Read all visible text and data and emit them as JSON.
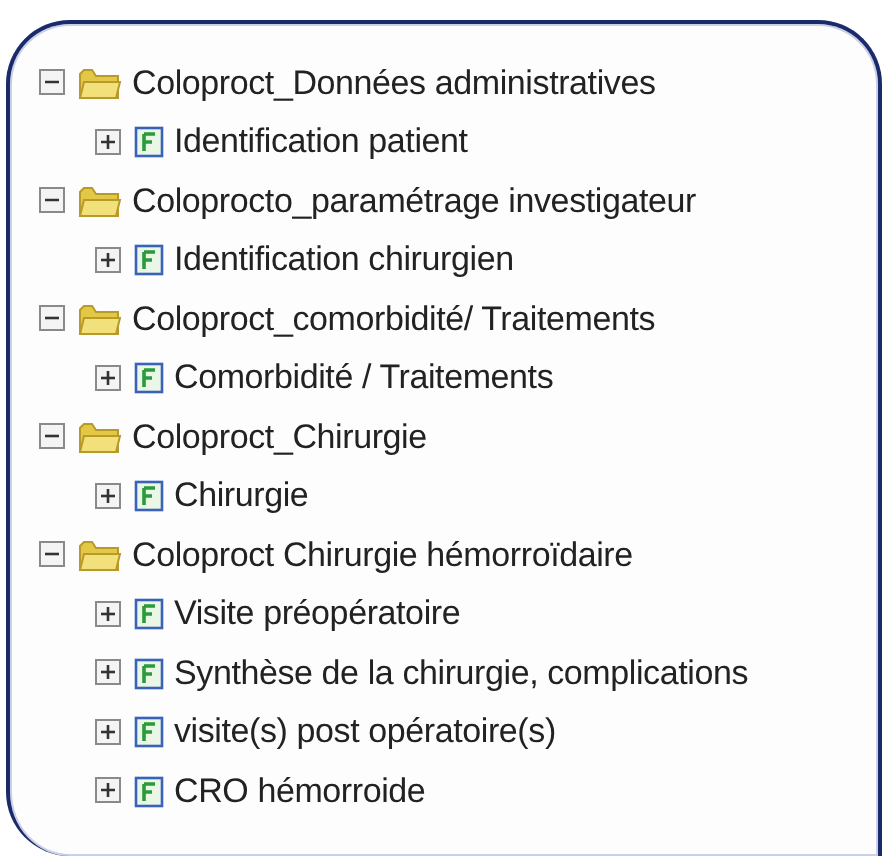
{
  "tree": [
    {
      "label": "Coloproct_Données administratives",
      "expanded": true,
      "children": [
        {
          "label": "Identification patient",
          "expanded": false
        }
      ]
    },
    {
      "label": "Coloprocto_paramétrage investigateur",
      "expanded": true,
      "children": [
        {
          "label": "Identification chirurgien",
          "expanded": false
        }
      ]
    },
    {
      "label": "Coloproct_comorbidité/ Traitements",
      "expanded": true,
      "children": [
        {
          "label": "Comorbidité / Traitements",
          "expanded": false
        }
      ]
    },
    {
      "label": "Coloproct_Chirurgie",
      "expanded": true,
      "children": [
        {
          "label": "Chirurgie",
          "expanded": false
        }
      ]
    },
    {
      "label": "Coloproct Chirurgie hémorroïdaire",
      "expanded": true,
      "children": [
        {
          "label": "Visite préopératoire",
          "expanded": false
        },
        {
          "label": "Synthèse de la chirurgie, complications",
          "expanded": false
        },
        {
          "label": "visite(s) post opératoire(s)",
          "expanded": false
        },
        {
          "label": "CRO hémorroide",
          "expanded": false
        }
      ]
    }
  ]
}
